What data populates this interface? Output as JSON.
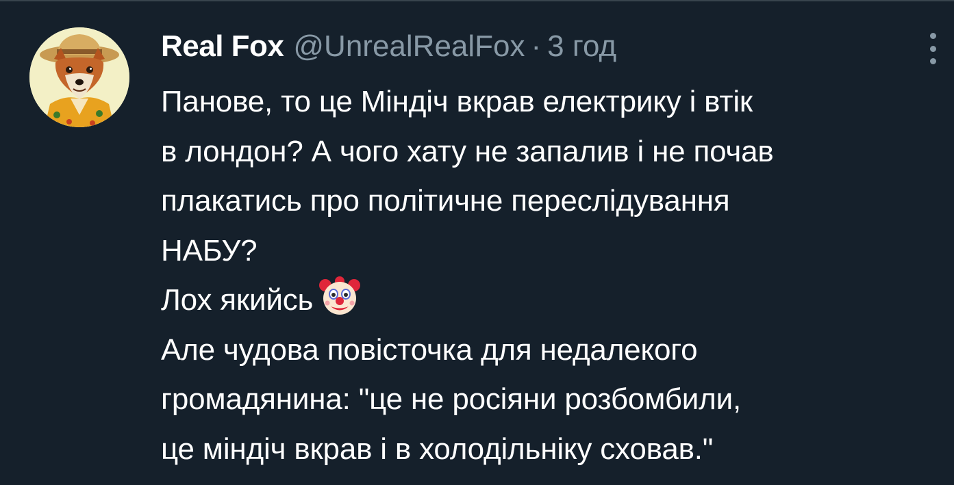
{
  "tweet": {
    "author_name": "Real Fox",
    "author_handle": "@UnrealRealFox",
    "separator": "·",
    "timestamp": "3 год",
    "avatar_icon": "fox-avatar",
    "more_icon": "more-vertical-icon",
    "lines": [
      "Панове, то це Міндіч вкрав електрику і втік",
      "в лондон? А чого хату не запалив і не почав",
      "плакатись про політичне переслідування",
      "НАБУ?",
      "Лох якийсь",
      "Але чудова повісточка для недалекого",
      "громадянина: \"це не росіяни розбомбили,",
      "це міндіч вкрав і в холодільніку сховав.\""
    ],
    "emoji": "clown-face-icon"
  },
  "colors": {
    "background": "#15202b",
    "text_primary": "#ffffff",
    "text_secondary": "#8899a6",
    "divider": "#38444d"
  }
}
